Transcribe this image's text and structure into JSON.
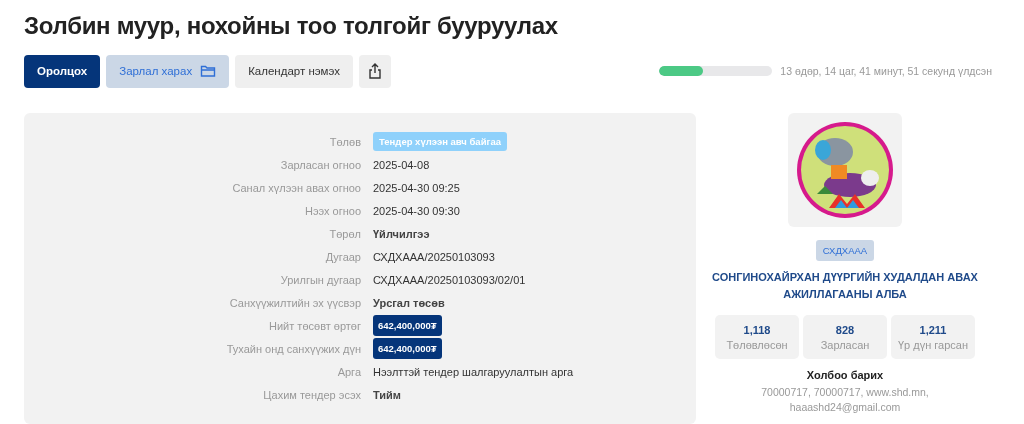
{
  "title": "Золбин муур, нохойны тоо толгойг бууруулах",
  "buttons": [
    {
      "label": "Оролцох",
      "kind": "primary"
    },
    {
      "label": "Зарлал харах",
      "kind": "secondary"
    },
    {
      "label": "Календарт нэмэх",
      "kind": "plain"
    }
  ],
  "countdown": {
    "level": 0.39,
    "text": "13 өдөр, 14 цаг, 41 минут, 51 секунд үлдсэн"
  },
  "details": [
    {
      "label": "Төлөв",
      "value": "Тендер хүлээн авч байгаа",
      "kind": "status"
    },
    {
      "label": "Зарласан огноо",
      "value": "2025-04-08",
      "kind": "text"
    },
    {
      "label": "Санал хүлээн авах огноо",
      "value": "2025-04-30 09:25",
      "kind": "text"
    },
    {
      "label": "Нээх огноо",
      "value": "2025-04-30 09:30",
      "kind": "text"
    },
    {
      "label": "Төрөл",
      "value": "Үйлчилгээ",
      "kind": "strong"
    },
    {
      "label": "Дугаар",
      "value": "СХДХААА/20250103093",
      "kind": "text"
    },
    {
      "label": "Урилгын дугаар",
      "value": "СХДХААА/20250103093/02/01",
      "kind": "text"
    },
    {
      "label": "Санхүүжилтийн эх үүсвэр",
      "value": "Урсгал төсөв",
      "kind": "strong"
    },
    {
      "label": "Нийт төсөвт өртөг",
      "value": "642,400,000₮",
      "kind": "money"
    },
    {
      "label": "Тухайн онд санхүүжих дүн",
      "value": "642,400,000₮",
      "kind": "money"
    },
    {
      "label": "Арга",
      "value": "Нээлттэй тендер шалгаруулалтын арга",
      "kind": "text"
    },
    {
      "label": "Цахим тендер эсэх",
      "value": "Тийм",
      "kind": "strong"
    }
  ],
  "organization": {
    "code": "СХДХААА",
    "name": "СОНГИНОХАЙРХАН ДҮҮРГИЙН ХУДАЛДАН АВАХ АЖИЛЛАГААНЫ АЛБА",
    "stats": [
      {
        "value": "1,118",
        "label": "Төлөвлөсөн"
      },
      {
        "value": "828",
        "label": "Зарласан"
      },
      {
        "value": "1,211",
        "label": "Үр дүн гарсан"
      }
    ],
    "contact_title": "Холбоо барих",
    "contact": "70000717, 70000717, www.shd.mn, haaashd24@gmail.com"
  }
}
